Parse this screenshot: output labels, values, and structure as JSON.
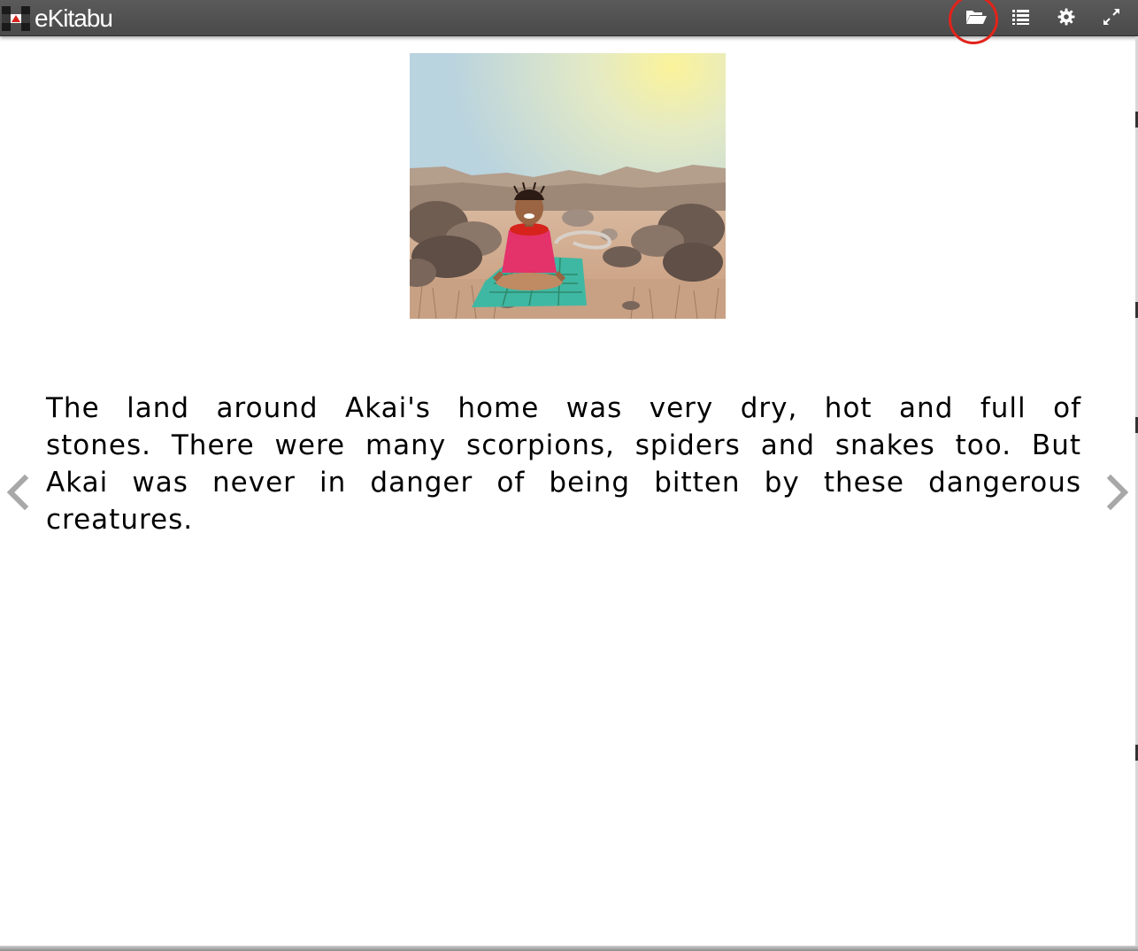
{
  "app": {
    "name": "eKitabu"
  },
  "toolbar": {
    "buttons": [
      {
        "icon": "folder-open-icon",
        "label": "Open library"
      },
      {
        "icon": "list-icon",
        "label": "Table of contents"
      },
      {
        "icon": "gear-icon",
        "label": "Settings"
      },
      {
        "icon": "expand-icon",
        "label": "Fullscreen"
      }
    ],
    "highlighted_button": "folder-open-icon"
  },
  "page": {
    "illustration": {
      "description": "girl sitting cross-legged on a green mat in a dry rocky landscape"
    },
    "text": "The land around Akai's home was very dry, hot and full of stones. There were many scorpions, spiders and snakes too. But Akai was never in danger of being bitten by these dangerous creatures."
  },
  "navigation": {
    "prev_icon": "chevron-left-icon",
    "next_icon": "chevron-right-icon"
  },
  "colors": {
    "toolbar_bg": "#4f4f4f",
    "toolbar_icon": "#ffffff",
    "highlight_ring": "#e2231a",
    "nav_arrow": "#a8a8a8",
    "text": "#000000"
  }
}
